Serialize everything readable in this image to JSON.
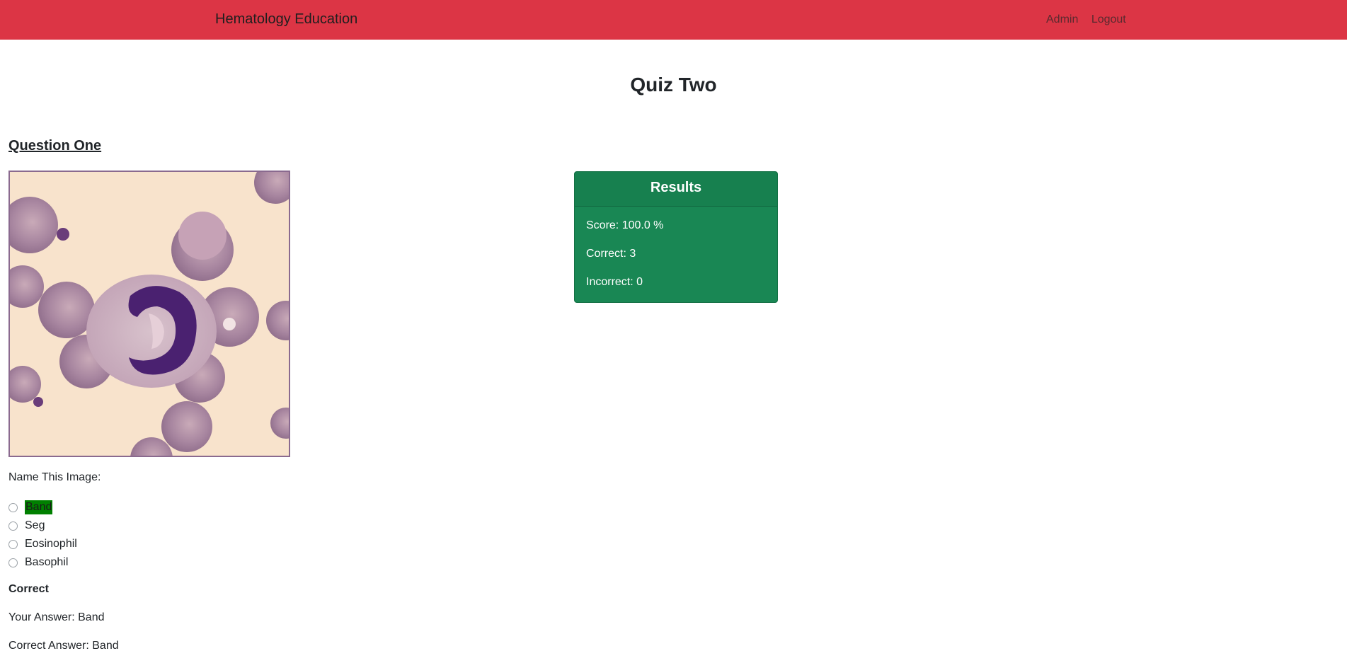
{
  "navbar": {
    "brand": "Hematology Education",
    "links": [
      "Admin",
      "Logout"
    ],
    "color": "#dc3545"
  },
  "page": {
    "title": "Quiz Two"
  },
  "question": {
    "heading": "Question One",
    "prompt": "Name This Image:",
    "options": [
      "Band",
      "Seg",
      "Eosinophil",
      "Basophil"
    ],
    "selected": "Band",
    "status": "Correct",
    "your_answer": "Your Answer: Band",
    "correct_answer": "Correct Answer: Band"
  },
  "results": {
    "title": "Results",
    "score": "Score: 100.0 %",
    "correct": "Correct: 3",
    "incorrect": "Incorrect: 0",
    "color": "#198754"
  }
}
